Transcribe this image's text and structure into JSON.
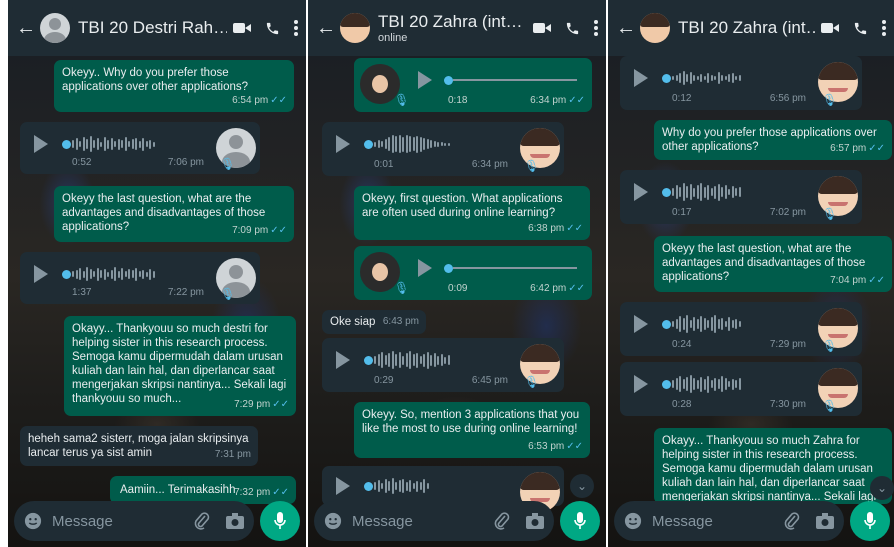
{
  "panel1": {
    "header": {
      "name": "TBI 20 Destri Rah…",
      "status": ""
    },
    "messages": [
      {
        "type": "text",
        "dir": "out",
        "text": "Okeyy.. Why do you prefer those applications over other applications?",
        "time": "6:54 pm"
      },
      {
        "type": "voice",
        "dir": "in",
        "duration": "0:52",
        "time": "7:06 pm"
      },
      {
        "type": "text",
        "dir": "out",
        "text": "Okeyy the last question, what are the advantages and disadvantages of those applications?",
        "time": "7:09 pm"
      },
      {
        "type": "voice",
        "dir": "in",
        "duration": "1:37",
        "time": "7:22 pm"
      },
      {
        "type": "text",
        "dir": "out",
        "text": "Okayy... Thankyouu so much destri for helping sister in this research process. Semoga kamu dipermudah dalam urusan kuliah dan lain hal, dan diperlancar saat mengerjakan skripsi nantinya... Sekali lagi thankyouu so much...",
        "time": "7:29 pm"
      },
      {
        "type": "text",
        "dir": "in",
        "text": "heheh sama2 sisterr, moga jalan skripsinya lancar terus ya sist amin",
        "time": "7:31 pm"
      },
      {
        "type": "text",
        "dir": "out",
        "text": "Aamiin... Terimakasihh",
        "time": "7:32 pm"
      }
    ],
    "composer_placeholder": "Message"
  },
  "panel2": {
    "header": {
      "name": "TBI 20 Zahra (int…",
      "status": "online"
    },
    "messages": [
      {
        "type": "voice",
        "dir": "out",
        "duration": "0:18",
        "time": "6:34 pm"
      },
      {
        "type": "voice",
        "dir": "in",
        "duration": "0:01",
        "time": "6:34 pm"
      },
      {
        "type": "text",
        "dir": "out",
        "text": "Okeyy, first question. What applications are often used during online learning?",
        "time": "6:38 pm"
      },
      {
        "type": "voice",
        "dir": "out",
        "duration": "0:09",
        "time": "6:42 pm"
      },
      {
        "type": "text",
        "dir": "in",
        "text": "Oke siap",
        "time": "6:43 pm"
      },
      {
        "type": "voice",
        "dir": "in",
        "duration": "0:29",
        "time": "6:45 pm"
      },
      {
        "type": "text",
        "dir": "out",
        "text": "Okeyy. So, mention 3 applications that you like the most to use during online learning!",
        "time": "6:53 pm"
      }
    ],
    "composer_placeholder": "Message"
  },
  "panel3": {
    "header": {
      "name": "TBI 20 Zahra (int…",
      "status": ""
    },
    "messages": [
      {
        "type": "voice",
        "dir": "in",
        "duration": "0:12",
        "time": "6:56 pm"
      },
      {
        "type": "text",
        "dir": "out",
        "text": "Why do you prefer those applications over other applications?",
        "time": "6:57 pm"
      },
      {
        "type": "voice",
        "dir": "in",
        "duration": "0:17",
        "time": "7:02 pm"
      },
      {
        "type": "text",
        "dir": "out",
        "text": "Okeyy the last question, what are the advantages and disadvantages of those applications?",
        "time": "7:04 pm"
      },
      {
        "type": "voice",
        "dir": "in",
        "duration": "0:24",
        "time": "7:29 pm"
      },
      {
        "type": "voice",
        "dir": "in",
        "duration": "0:28",
        "time": "7:30 pm"
      },
      {
        "type": "text",
        "dir": "out",
        "text": "Okayy... Thankyouu so much Zahra for helping sister in this research process. Semoga kamu dipermudah dalam urusan kuliah dan lain hal, dan diperlancar saat mengerjakan skripsi nantinya... Sekali lagi",
        "time": ""
      }
    ],
    "composer_placeholder": "Message"
  },
  "ticks": "✓✓",
  "colors": {
    "outgoing": "#005c4b",
    "incoming": "#1f2c34",
    "accent": "#00a884",
    "read_tick": "#53bdeb"
  }
}
